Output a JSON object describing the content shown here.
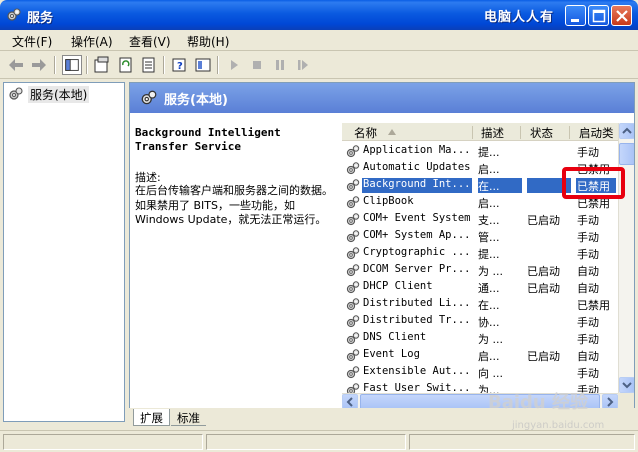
{
  "window": {
    "title": "服务",
    "watermark": "电脑人人有"
  },
  "menu": [
    {
      "label": "文件(F)"
    },
    {
      "label": "操作(A)"
    },
    {
      "label": "查看(V)"
    },
    {
      "label": "帮助(H)"
    }
  ],
  "tree": {
    "root_label": "服务(本地)"
  },
  "panel": {
    "header_title": "服务(本地)",
    "service_title": "Background Intelligent Transfer Service",
    "desc_label": "描述:",
    "desc_text": "在后台传输客户端和服务器之间的数据。如果禁用了 BITS，一些功能，如 Windows Update，就无法正常运行。"
  },
  "columns": {
    "name": "名称",
    "desc": "描述",
    "status": "状态",
    "startup": "启动类"
  },
  "services": [
    {
      "name": "Application Ma...",
      "desc": "提...",
      "status": "",
      "startup": "手动"
    },
    {
      "name": "Automatic Updates",
      "desc": "启...",
      "status": "",
      "startup": "已禁用"
    },
    {
      "name": "Background Int...",
      "desc": "在...",
      "status": "",
      "startup": "已禁用",
      "selected": true
    },
    {
      "name": "ClipBook",
      "desc": "启...",
      "status": "",
      "startup": "已禁用"
    },
    {
      "name": "COM+ Event System",
      "desc": "支...",
      "status": "已启动",
      "startup": "手动"
    },
    {
      "name": "COM+ System Ap...",
      "desc": "管...",
      "status": "",
      "startup": "手动"
    },
    {
      "name": "Cryptographic ...",
      "desc": "提...",
      "status": "",
      "startup": "手动"
    },
    {
      "name": "DCOM Server Pr...",
      "desc": "为 ...",
      "status": "已启动",
      "startup": "自动"
    },
    {
      "name": "DHCP Client",
      "desc": "通...",
      "status": "已启动",
      "startup": "自动"
    },
    {
      "name": "Distributed Li...",
      "desc": "在...",
      "status": "",
      "startup": "已禁用"
    },
    {
      "name": "Distributed Tr...",
      "desc": "协...",
      "status": "",
      "startup": "手动"
    },
    {
      "name": "DNS Client",
      "desc": "为 ...",
      "status": "",
      "startup": "手动"
    },
    {
      "name": "Event Log",
      "desc": "启...",
      "status": "已启动",
      "startup": "自动"
    },
    {
      "name": "Extensible Aut...",
      "desc": "向 ...",
      "status": "",
      "startup": "手动"
    },
    {
      "name": "Fast User Swit...",
      "desc": "为...",
      "status": "",
      "startup": "手动"
    }
  ],
  "tabs": [
    {
      "label": "扩展"
    },
    {
      "label": "标准"
    }
  ],
  "watermark_bottom": "Baidu 经验",
  "watermark_bottom_url": "jingyan.baidu.com"
}
